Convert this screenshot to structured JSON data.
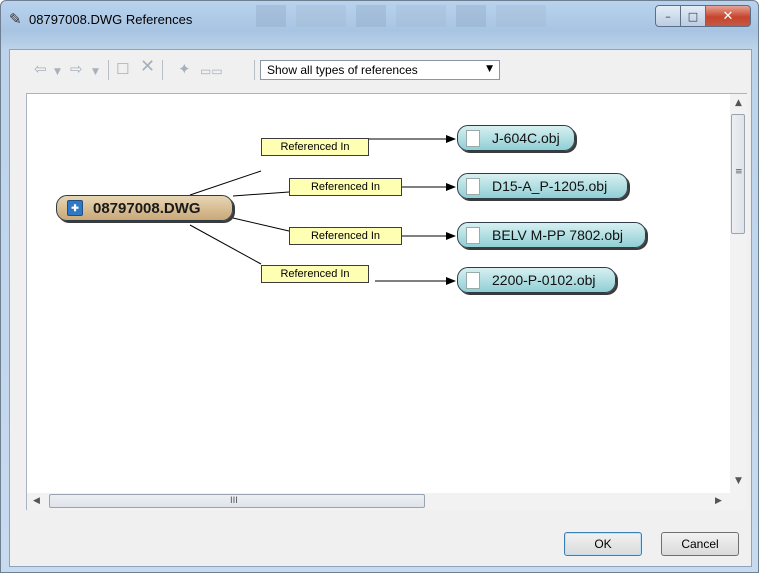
{
  "window": {
    "title": "08797008.DWG References",
    "title_icon": "references-icon",
    "caption_buttons": {
      "minimize": "–",
      "maximize": "□",
      "close": "✕"
    }
  },
  "toolbar": {
    "icons": [
      "back-arrow-icon",
      "dropdown-arrow-icon",
      "forward-arrow-icon",
      "dropdown-arrow-icon",
      "properties-icon",
      "delete-icon",
      "hierarchy-icon",
      "layout-icon"
    ],
    "filter": {
      "selected": "Show all types of references"
    }
  },
  "graph": {
    "root": {
      "label": "08797008.DWG",
      "icon": "dwg-file-icon"
    },
    "relation_label": "Referenced In",
    "references": [
      {
        "label": "J-604C.obj",
        "relation": "Referenced In",
        "icon": "file-icon"
      },
      {
        "label": "D15-A_P-1205.obj",
        "relation": "Referenced In",
        "icon": "file-icon"
      },
      {
        "label": "BELV M-PP 7802.obj",
        "relation": "Referenced In",
        "icon": "file-icon"
      },
      {
        "label": "2200-P-0102.obj",
        "relation": "Referenced In",
        "icon": "file-icon"
      }
    ]
  },
  "scrollbar": {
    "h_grip": "III",
    "v_grip": "≡"
  },
  "buttons": {
    "ok": "OK",
    "cancel": "Cancel"
  },
  "colors": {
    "root_node": "#c9a878",
    "ref_node": "#8fcfd4",
    "relation_label": "#ffffb4"
  }
}
